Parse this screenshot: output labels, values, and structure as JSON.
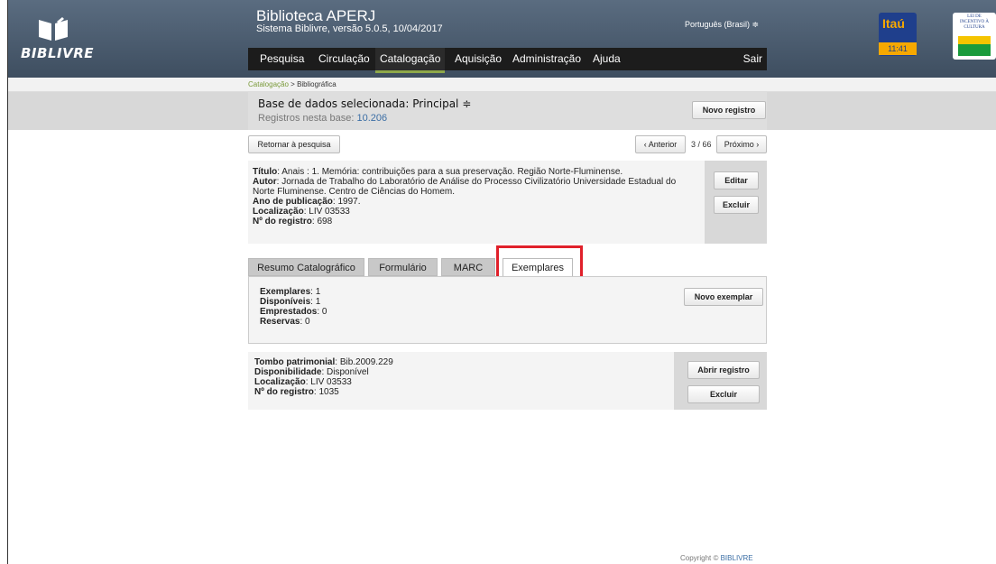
{
  "header": {
    "logo_text": "BIBLIVRE",
    "title": "Biblioteca APERJ",
    "subtitle": "Sistema Biblivre, versão 5.0.5, 10/04/2017",
    "language": "Português (Brasil) ≑"
  },
  "nav": {
    "items": [
      "Pesquisa",
      "Circulação",
      "Catalogação",
      "Aquisição",
      "Administração",
      "Ajuda"
    ],
    "exit_label": "Sair",
    "active": "Catalogação"
  },
  "sponsors": {
    "itau": "Itaú",
    "time": "11:41",
    "lei": "LEI DE INCENTIVO À CULTURA"
  },
  "breadcrumb": {
    "section": "Catalogação",
    "page": "Bibliográfica"
  },
  "database": {
    "label": "Base de dados selecionada:  Principal ≑",
    "count_label": "Registros nesta base:",
    "count_value": "10.206",
    "new_record_label": "Novo registro"
  },
  "pager": {
    "back_label": "Retornar à pesquisa",
    "prev_label": "‹ Anterior",
    "position": "3 / 66",
    "next_label": "Próximo ›"
  },
  "record": {
    "title_label": "Título",
    "title_value": ": Anais : 1. Memória: contribuições para a sua preservação. Região Norte-Fluminense.",
    "author_label": "Autor",
    "author_value": ": Jornada de Trabalho do Laboratório de Análise do Processo Civilizatório Universidade Estadual do Norte Fluminense. Centro de Ciências do Homem.",
    "year_label": "Ano de publicação",
    "year_value": ": 1997.",
    "location_label": "Localização",
    "location_value": ": LIV 03533",
    "regno_label": "Nº do registro",
    "regno_value": ": 698",
    "edit_label": "Editar",
    "delete_label": "Excluir"
  },
  "tabs": {
    "items": [
      "Resumo Catalográfico",
      "Formulário",
      "MARC",
      "Exemplares"
    ],
    "active": "Exemplares"
  },
  "summary": {
    "copies_label": "Exemplares",
    "copies_value": ": 1",
    "available_label": "Disponíveis",
    "available_value": ": 1",
    "loaned_label": "Emprestados",
    "loaned_value": ": 0",
    "reserves_label": "Reservas",
    "reserves_value": ": 0",
    "new_copy_label": "Novo exemplar"
  },
  "copy": {
    "tombo_label": "Tombo patrimonial",
    "tombo_value": ": Bib.2009.229",
    "availability_label": "Disponibilidade",
    "availability_value": ": Disponível",
    "location_label": "Localização",
    "location_value": ": LIV 03533",
    "regno_label": "Nº do registro",
    "regno_value": ": 1035",
    "open_label": "Abrir registro",
    "delete_label": "Excluir"
  },
  "footer": {
    "copyright": "Copyright ©",
    "link": "BIBLIVRE"
  },
  "colors": {
    "header": "#4a5b6e",
    "accent": "#8ea84a",
    "highlight": "#e0202a"
  }
}
